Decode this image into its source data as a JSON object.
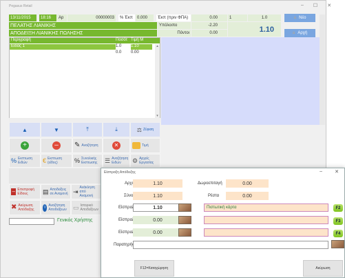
{
  "window": {
    "title": "Pegasus Retail"
  },
  "header": {
    "date": "13/11/2015",
    "time": "18:16",
    "ap_label": "Ap",
    "doc_number": "00000003",
    "discount_label": "% Έκπ",
    "discount_value": "0.000",
    "discount_amount_label": "Έκπ (πριν ΦΠΑ)",
    "discount_amount_value": "0.00",
    "qty_value": "1",
    "price_value": "1.0",
    "customer": "ΠΕΛΑΤΗΣ ΛΙΑΝΙΚΗΣ",
    "doc_type": "ΑΠΟΔΕΙΞΗ ΛΙΑΝΙΚΗΣ ΠΩΛΗΣΗΣ",
    "remaining_label": "Υπόλοιπο",
    "remaining_value": "-2.20",
    "points_label": "Πόντοι",
    "points_value": "0.00",
    "total_value": "1.10",
    "btn_new": "Νέο",
    "btn_save": "Αρχή"
  },
  "table": {
    "headers": [
      "Περιγραφή",
      "Ποσότ",
      "Τιμή Μ"
    ],
    "rows": [
      {
        "desc": "Είδος 1",
        "qty": "1.0",
        "price": "1.10"
      },
      {
        "desc": "",
        "qty": "0.0",
        "price": "0.00"
      }
    ]
  },
  "toolbar": {
    "scale_label": "Ζύγιση",
    "search_label": "Αναζήτηση",
    "delete_label": "Τιμή",
    "items_search": "Εκπτωση Ειδών",
    "discount_item": "Εκπτωση (είδος)",
    "discount_total": "Συνολικής Εκπτωσης",
    "search_items2": "Αναζήτηση Ειδών",
    "cash_drawer": "Αρχείς Εργασίας",
    "return_item": "Επιστροφή Είδους",
    "credit_note": "Αποδείξεις σε Αναμονή",
    "rec_receipt": "Ανάκληση από Αναμονή",
    "cancel_receipt": "Ακύρωση Απόδειξης",
    "print": "Αναζήτηση Αποδείξεων",
    "history": "Ιστορικό Αποδείξεων",
    "user_label": "Γενικός Χρήστης"
  },
  "dialog": {
    "title": "Είσπραξη Απόδειξης",
    "initial_label": "Αρχικό",
    "initial_value": "1.10",
    "gift_label": "Δωροεπιταγή",
    "gift_value": "0.00",
    "total_label": "Σύνολο",
    "total_value": "1.10",
    "change_label": "Ρέστα",
    "change_value": "0.00",
    "pay1_label": "Είσπραξη 1",
    "pay1_value": "1.10",
    "pay1_method": "Πιστωτική κάρτα",
    "pay2_label": "Είσπραξη 2",
    "pay2_value": "0.00",
    "pay3_label": "Είσπραξη 3",
    "pay3_value": "0.00",
    "notes_label": "Παρατηρήσεις",
    "f2": "F2",
    "f3": "F3",
    "f4": "F4",
    "confirm_btn": "F12=Καταχώρηση",
    "cancel_btn": "Ακύρωση"
  },
  "colors": {
    "green": "#77b82f",
    "grid": "#d6dcfb",
    "orange": "#fde4c9"
  }
}
